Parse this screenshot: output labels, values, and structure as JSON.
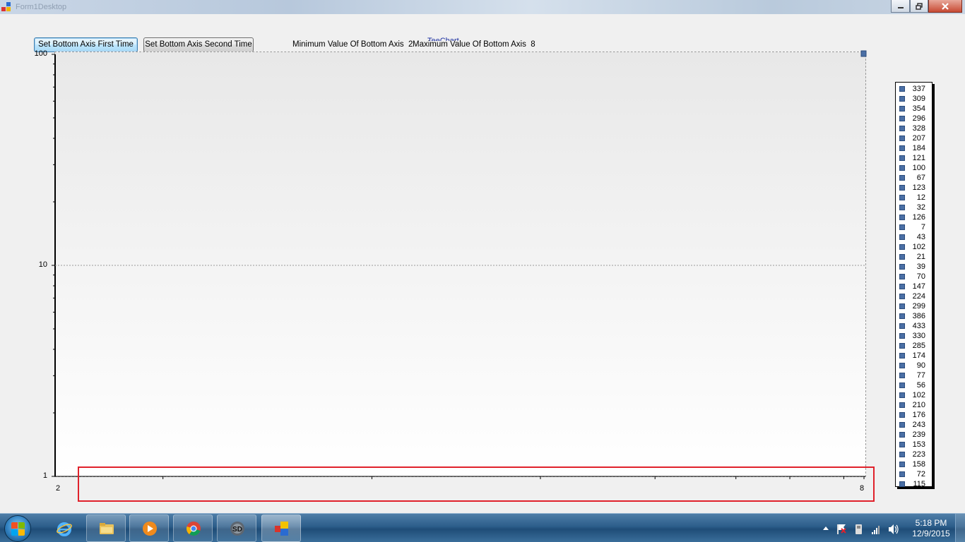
{
  "window": {
    "title": "Form1Desktop"
  },
  "toolbar": {
    "first_button": "Set Bottom Axis First Time",
    "second_button": "Set Bottom Axis Second Time",
    "min_text": "Minimum Value Of Bottom Axis  2",
    "max_text": "Maximum Value Of Bottom Axis  8"
  },
  "chart_data": {
    "type": "line",
    "title": "TeeChart",
    "y_scale": "log",
    "ylim": [
      1,
      100
    ],
    "xlim": [
      2,
      8
    ],
    "y_tick_labels": [
      "100",
      "10",
      "1"
    ],
    "x_tick_labels": [
      "2",
      "8"
    ],
    "grid": true,
    "legend_position": "right",
    "legend_color": "#4a6fa5",
    "legend": [
      "337",
      "309",
      "354",
      "296",
      "328",
      "207",
      "184",
      "121",
      "100",
      "67",
      "123",
      "12",
      "32",
      "126",
      "7",
      "43",
      "102",
      "21",
      "39",
      "70",
      "147",
      "224",
      "299",
      "386",
      "433",
      "330",
      "285",
      "174",
      "90",
      "77",
      "56",
      "102",
      "210",
      "176",
      "243",
      "239",
      "153",
      "223",
      "158",
      "72",
      "115"
    ]
  },
  "annotation": {
    "highlight_color": "#e0212b"
  },
  "taskbar": {
    "apps": [
      "start-icon",
      "internet-explorer-icon",
      "file-explorer-icon",
      "media-player-icon",
      "chrome-icon",
      "sd-app-icon",
      "teechart-app-icon"
    ],
    "time": "5:18 PM",
    "date": "12/9/2015"
  }
}
